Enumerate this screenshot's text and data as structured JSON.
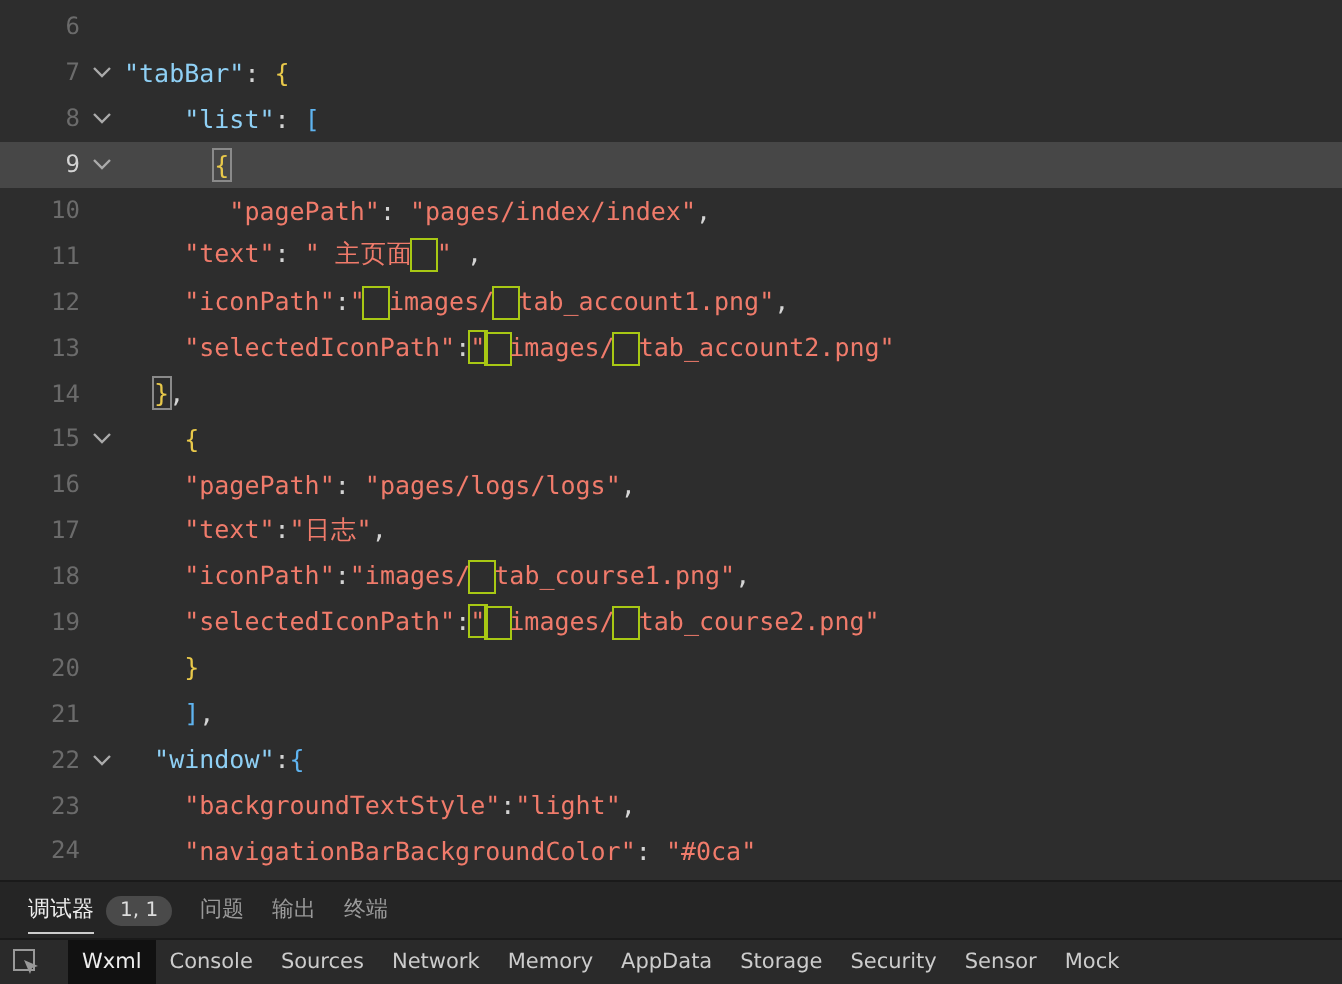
{
  "editor": {
    "lines": [
      {
        "number": "6",
        "fold": false,
        "current": false
      },
      {
        "number": "7",
        "fold": true,
        "current": false,
        "kind": "flush",
        "tokens": [
          {
            "kind": "top-key",
            "text": "\"tabBar\""
          },
          {
            "kind": "punct",
            "text": ": "
          },
          {
            "kind": "brace",
            "text": "{"
          }
        ]
      },
      {
        "number": "8",
        "fold": true,
        "current": false,
        "kind": "normal",
        "tokens": [
          {
            "kind": "top-key",
            "text": "\"list\""
          },
          {
            "kind": "punct",
            "text": ": "
          },
          {
            "kind": "bracket",
            "text": "["
          }
        ]
      },
      {
        "number": "9",
        "fold": true,
        "current": true,
        "kind": "deep",
        "tokens": [
          {
            "kind": "matched",
            "text": "{"
          }
        ]
      },
      {
        "number": "10",
        "fold": false,
        "current": false,
        "kind": "deeper",
        "tokens": [
          {
            "kind": "key",
            "text": "\"pagePath\""
          },
          {
            "kind": "punct",
            "text": ": "
          },
          {
            "kind": "string",
            "text": "\"pages/index/index\""
          },
          {
            "kind": "punct",
            "text": ","
          }
        ]
      },
      {
        "number": "11",
        "fold": false,
        "current": false,
        "kind": "normal",
        "tokens": [
          {
            "kind": "key",
            "text": "\"text\""
          },
          {
            "kind": "punct",
            "text": ": "
          },
          {
            "kind": "string",
            "text": "\" 主页面"
          },
          {
            "kind": "blank-flag"
          },
          {
            "kind": "string",
            "text": "\""
          },
          {
            "kind": "punct",
            "text": " ,"
          }
        ]
      },
      {
        "number": "12",
        "fold": false,
        "current": false,
        "kind": "normal",
        "tokens": [
          {
            "kind": "key",
            "text": "\"iconPath\""
          },
          {
            "kind": "punct",
            "text": ":"
          },
          {
            "kind": "string",
            "text": "\""
          },
          {
            "kind": "blank-flag"
          },
          {
            "kind": "string",
            "text": "images/"
          },
          {
            "kind": "blank-flag"
          },
          {
            "kind": "string",
            "text": "tab_account1.png\""
          },
          {
            "kind": "punct",
            "text": ","
          }
        ]
      },
      {
        "number": "13",
        "fold": false,
        "current": false,
        "kind": "normal",
        "tokens": [
          {
            "kind": "key",
            "text": "\"selectedIconPath\""
          },
          {
            "kind": "punct",
            "text": ":"
          },
          {
            "kind": "flagged",
            "text": "\""
          },
          {
            "kind": "blank-flag"
          },
          {
            "kind": "string",
            "text": "images/"
          },
          {
            "kind": "blank-flag"
          },
          {
            "kind": "string",
            "text": "tab_account2.png\""
          }
        ]
      },
      {
        "number": "14",
        "fold": false,
        "current": false,
        "kind": "shallow",
        "tokens": [
          {
            "kind": "matched",
            "text": "}"
          },
          {
            "kind": "punct",
            "text": ","
          }
        ]
      },
      {
        "number": "15",
        "fold": true,
        "current": false,
        "kind": "normal",
        "tokens": [
          {
            "kind": "brace",
            "text": "{"
          }
        ]
      },
      {
        "number": "16",
        "fold": false,
        "current": false,
        "kind": "normal",
        "tokens": [
          {
            "kind": "key",
            "text": "\"pagePath\""
          },
          {
            "kind": "punct",
            "text": ": "
          },
          {
            "kind": "string",
            "text": "\"pages/logs/logs\""
          },
          {
            "kind": "punct",
            "text": ","
          }
        ]
      },
      {
        "number": "17",
        "fold": false,
        "current": false,
        "kind": "normal",
        "tokens": [
          {
            "kind": "key",
            "text": "\"text\""
          },
          {
            "kind": "punct",
            "text": ":"
          },
          {
            "kind": "string",
            "text": "\"日志\""
          },
          {
            "kind": "punct",
            "text": ","
          }
        ]
      },
      {
        "number": "18",
        "fold": false,
        "current": false,
        "kind": "normal",
        "tokens": [
          {
            "kind": "key",
            "text": "\"iconPath\""
          },
          {
            "kind": "punct",
            "text": ":"
          },
          {
            "kind": "string",
            "text": "\"images/"
          },
          {
            "kind": "blank-flag"
          },
          {
            "kind": "string",
            "text": "tab_course1.png\""
          },
          {
            "kind": "punct",
            "text": ","
          }
        ]
      },
      {
        "number": "19",
        "fold": false,
        "current": false,
        "kind": "normal",
        "tokens": [
          {
            "kind": "key",
            "text": "\"selectedIconPath\""
          },
          {
            "kind": "punct",
            "text": ":"
          },
          {
            "kind": "flagged",
            "text": "\""
          },
          {
            "kind": "blank-flag"
          },
          {
            "kind": "string",
            "text": "images/"
          },
          {
            "kind": "blank-flag"
          },
          {
            "kind": "string",
            "text": "tab_course2.png\""
          }
        ]
      },
      {
        "number": "20",
        "fold": false,
        "current": false,
        "kind": "normal",
        "tokens": [
          {
            "kind": "brace",
            "text": "}"
          }
        ]
      },
      {
        "number": "21",
        "fold": false,
        "current": false,
        "kind": "normal",
        "tokens": [
          {
            "kind": "bracket",
            "text": "]"
          },
          {
            "kind": "punct",
            "text": ","
          }
        ]
      },
      {
        "number": "22",
        "fold": true,
        "current": false,
        "kind": "shallow",
        "tokens": [
          {
            "kind": "top-key",
            "text": "\"window\""
          },
          {
            "kind": "punct",
            "text": ":"
          },
          {
            "kind": "bracket",
            "text": "{"
          }
        ]
      },
      {
        "number": "23",
        "fold": false,
        "current": false,
        "kind": "normal",
        "tokens": [
          {
            "kind": "key",
            "text": "\"backgroundTextStyle\""
          },
          {
            "kind": "punct",
            "text": ":"
          },
          {
            "kind": "string",
            "text": "\"light\""
          },
          {
            "kind": "punct",
            "text": ","
          }
        ]
      },
      {
        "number": "24",
        "fold": false,
        "current": false,
        "kind": "normal",
        "tokens": [
          {
            "kind": "key",
            "text": "\"navigationBarBackgroundColor\""
          },
          {
            "kind": "punct",
            "text": ": "
          },
          {
            "kind": "string",
            "text": "\"#0ca\""
          }
        ]
      }
    ]
  },
  "panel_tabs": [
    {
      "label": "调试器",
      "selected": true,
      "badge": "1, 1"
    },
    {
      "label": "问题",
      "selected": false
    },
    {
      "label": "输出",
      "selected": false
    },
    {
      "label": "终端",
      "selected": false
    }
  ],
  "devtools_tabs": [
    {
      "label": "Wxml",
      "selected": true
    },
    {
      "label": "Console",
      "selected": false
    },
    {
      "label": "Sources",
      "selected": false
    },
    {
      "label": "Network",
      "selected": false
    },
    {
      "label": "Memory",
      "selected": false
    },
    {
      "label": "AppData",
      "selected": false
    },
    {
      "label": "Storage",
      "selected": false
    },
    {
      "label": "Security",
      "selected": false
    },
    {
      "label": "Sensor",
      "selected": false
    },
    {
      "label": "Mock",
      "selected": false
    }
  ]
}
